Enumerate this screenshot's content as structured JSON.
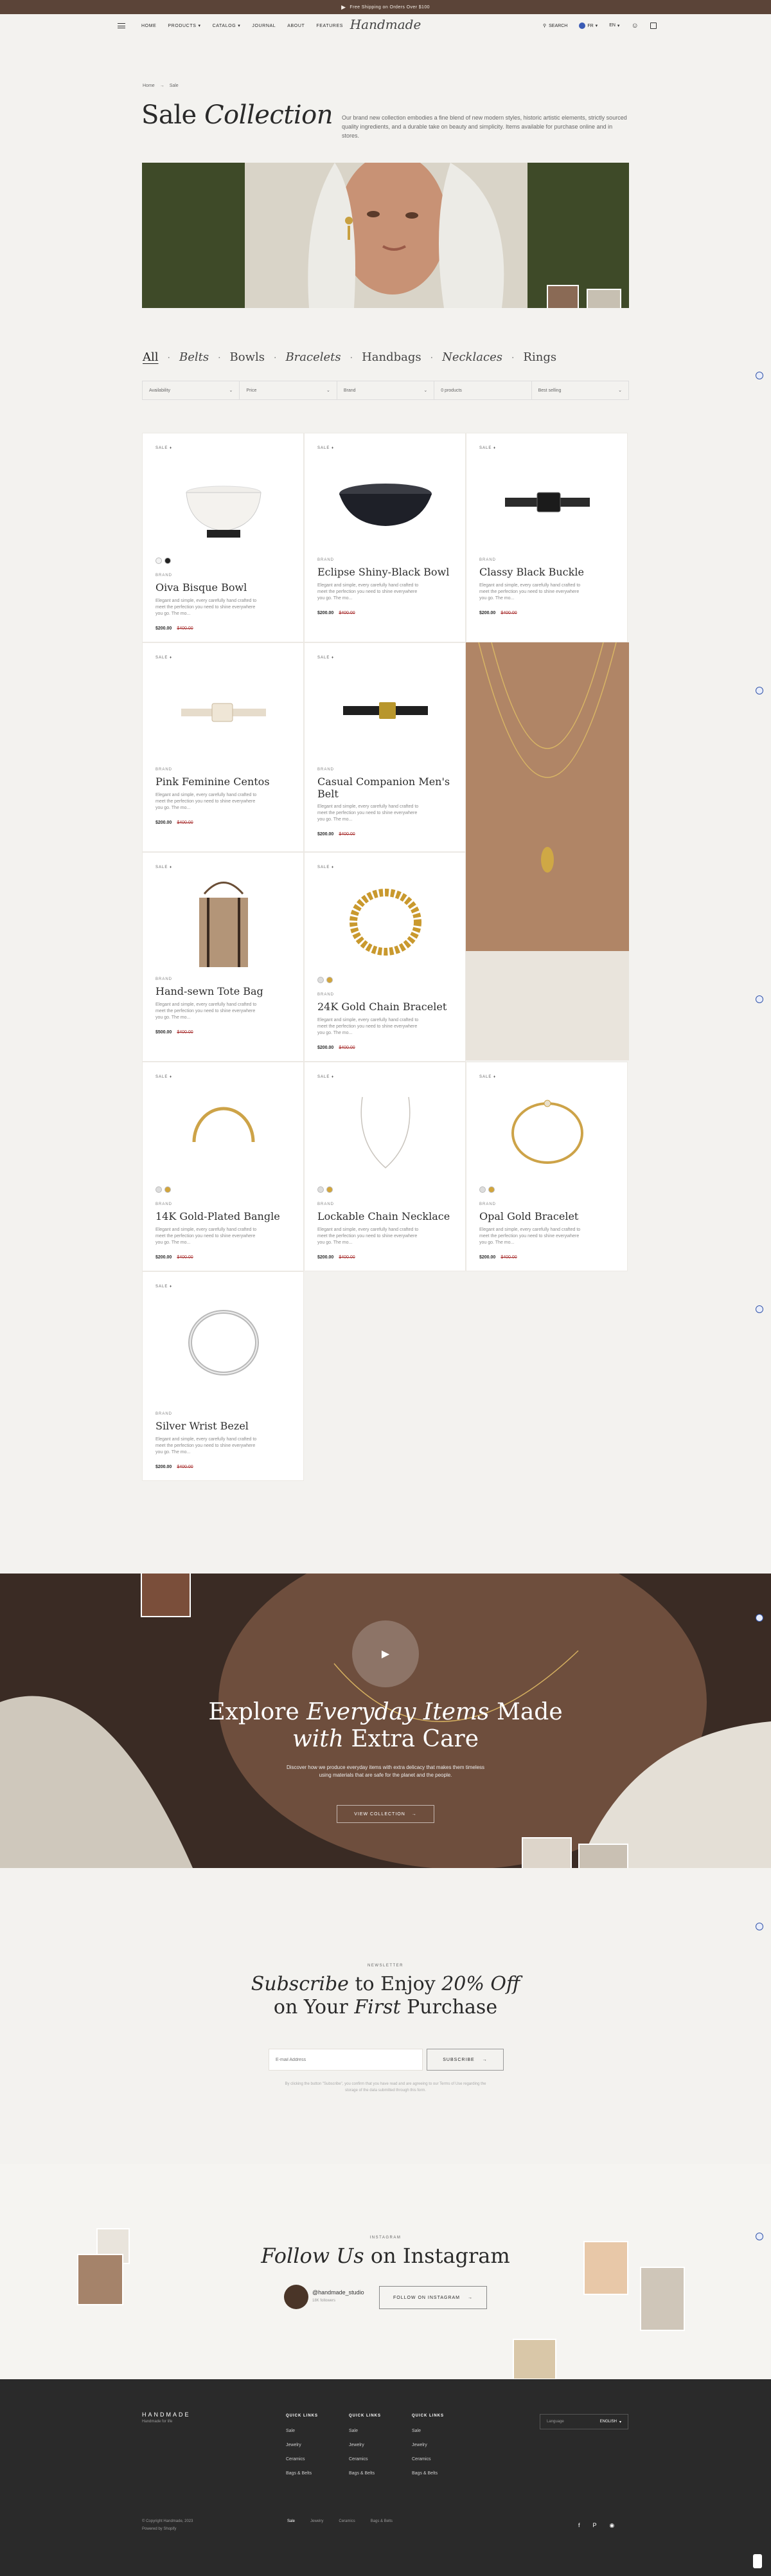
{
  "topbar": {
    "text": "Free Shipping on Orders Over $100"
  },
  "header": {
    "nav": [
      "HOME",
      "PRODUCTS",
      "CATALOG",
      "JOURNAL",
      "ABOUT",
      "FEATURES"
    ],
    "logo": "Handmade",
    "search": "SEARCH",
    "currency": "FR",
    "language": "EN"
  },
  "breadcrumb": {
    "home": "Home",
    "current": "Sale"
  },
  "page": {
    "title_plain": "Sale",
    "title_italic": "Collection",
    "intro": "Our brand new collection embodies a fine blend of new modern styles, historic artistic elements, strictly sourced quality ingredients, and a durable take on beauty and simplicity. Items available for purchase online and in stores."
  },
  "categories": [
    "All",
    "Belts",
    "Bowls",
    "Bracelets",
    "Handbags",
    "Necklaces",
    "Rings"
  ],
  "filters": [
    "Availability",
    "Price",
    "Brand",
    "0 products",
    "Best selling"
  ],
  "products": [
    {
      "sale": "SALE",
      "vendor": "BRAND",
      "name": "Oiva Bisque Bowl",
      "desc": "Elegant and simple, every carefully hand crafted to meet the perfection you need to shine everywhere you go. The mo...",
      "price": "$200.00",
      "was": "$400.00"
    },
    {
      "sale": "SALE",
      "vendor": "BRAND",
      "name": "Eclipse Shiny-Black Bowl",
      "desc": "Elegant and simple, every carefully hand crafted to meet the perfection you need to shine everywhere you go. The mo...",
      "price": "$200.00",
      "was": "$400.00"
    },
    {
      "sale": "SALE",
      "vendor": "BRAND",
      "name": "Classy Black Buckle",
      "desc": "Elegant and simple, every carefully hand crafted to meet the perfection you need to shine everywhere you go. The mo...",
      "price": "$200.00",
      "was": "$400.00"
    },
    {
      "sale": "SALE",
      "vendor": "BRAND",
      "name": "Pink Feminine Centos",
      "desc": "Elegant and simple, every carefully hand crafted to meet the perfection you need to shine everywhere you go. The mo...",
      "price": "$200.00",
      "was": "$400.00"
    },
    {
      "sale": "SALE",
      "vendor": "BRAND",
      "name": "Casual Companion Men's Belt",
      "desc": "Elegant and simple, every carefully hand crafted to meet the perfection you need to shine everywhere you go. The mo...",
      "price": "$200.00",
      "was": "$400.00"
    },
    {
      "sale": "SALE",
      "vendor": "BRAND",
      "name": "Hand-sewn Tote Bag",
      "desc": "Elegant and simple, every carefully hand crafted to meet the perfection you need to shine everywhere you go. The mo...",
      "price": "$500.00",
      "was": "$400.00"
    },
    {
      "sale": "SALE",
      "vendor": "BRAND",
      "name": "24K Gold Chain Bracelet",
      "desc": "Elegant and simple, every carefully hand crafted to meet the perfection you need to shine everywhere you go. The mo...",
      "price": "$200.00",
      "was": "$400.00"
    },
    {
      "sale": "SALE",
      "vendor": "BRAND",
      "name": "14K Gold-Plated Bangle",
      "desc": "Elegant and simple, every carefully hand crafted to meet the perfection you need to shine everywhere you go. The mo...",
      "price": "$200.00",
      "was": "$400.00"
    },
    {
      "sale": "SALE",
      "vendor": "BRAND",
      "name": "Lockable Chain Necklace",
      "desc": "Elegant and simple, every carefully hand crafted to meet the perfection you need to shine everywhere you go. The mo...",
      "price": "$200.00",
      "was": "$400.00"
    },
    {
      "sale": "SALE",
      "vendor": "BRAND",
      "name": "Opal Gold Bracelet",
      "desc": "Elegant and simple, every carefully hand crafted to meet the perfection you need to shine everywhere you go. The mo...",
      "price": "$200.00",
      "was": "$400.00"
    },
    {
      "sale": "SALE",
      "vendor": "BRAND",
      "name": "Silver Wrist Bezel",
      "desc": "Elegant and simple, every carefully hand crafted to meet the perfection you need to shine everywhere you go. The mo...",
      "price": "$200.00",
      "was": "$400.00"
    }
  ],
  "video": {
    "title_a": "Explore",
    "title_italic": "Everyday Items",
    "title_b": "Made",
    "title_italic2": "with",
    "title_c": "Extra Care",
    "body": "Discover how we produce everyday items with extra delicacy that makes them timeless using materials that are safe for the planet and the people.",
    "button": "VIEW COLLECTION"
  },
  "newsletter": {
    "label": "NEWSLETTER",
    "title_italic": "Subscribe",
    "title_a": "to Enjoy",
    "title_italic2": "20% Off",
    "title_b": "on Your",
    "title_italic3": "First",
    "title_c": "Purchase",
    "placeholder": "E-mail Address",
    "button": "SUBSCRIBE",
    "legal": "By clicking the button \"Subscribe\", you confirm that you have read and are agreeing to our Terms of Use regarding the storage of the data submitted through this form."
  },
  "follow": {
    "label": "INSTAGRAM",
    "title_italic": "Follow Us",
    "title_b": "on Instagram",
    "handle": "@handmade_studio",
    "followers": "18K followers",
    "button": "FOLLOW ON INSTAGRAM"
  },
  "footer": {
    "brand": "HANDMADE",
    "tagline": "Handmade for life",
    "columns": [
      {
        "title": "QUICK LINKS",
        "items": [
          "Sale",
          "Jewelry",
          "Ceramics",
          "Bags & Belts"
        ]
      },
      {
        "title": "QUICK LINKS",
        "items": [
          "Sale",
          "Jewelry",
          "Ceramics",
          "Bags & Belts"
        ]
      },
      {
        "title": "QUICK LINKS",
        "items": [
          "Sale",
          "Jewelry",
          "Ceramics",
          "Bags & Belts"
        ]
      }
    ],
    "language_label": "Language",
    "language": "ENGLISH",
    "copyright": "© Copyright Handmade, 2023",
    "powered": "Powered by Shopify",
    "legal_links": [
      "Sale",
      "Jewelry",
      "Ceramics",
      "Bags & Belts"
    ]
  }
}
